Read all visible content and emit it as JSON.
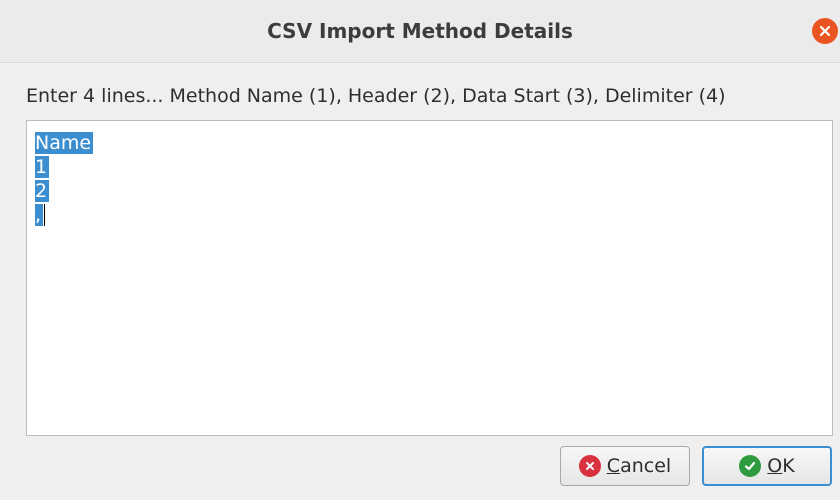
{
  "dialog": {
    "title": "CSV Import Method Details",
    "close_icon": "close-icon",
    "instruction": "Enter 4 lines... Method Name (1), Header (2), Data Start (3), Delimiter (4)",
    "textarea": {
      "lines": [
        "Name",
        "1",
        "2",
        ","
      ]
    },
    "buttons": {
      "cancel_mnemonic": "C",
      "cancel_rest": "ancel",
      "ok_mnemonic": "O",
      "ok_rest": "K"
    }
  },
  "colors": {
    "accent": "#e95420",
    "selection": "#3b8fd1",
    "cancel_icon": "#d8313f",
    "ok_icon": "#2e9b3f"
  }
}
